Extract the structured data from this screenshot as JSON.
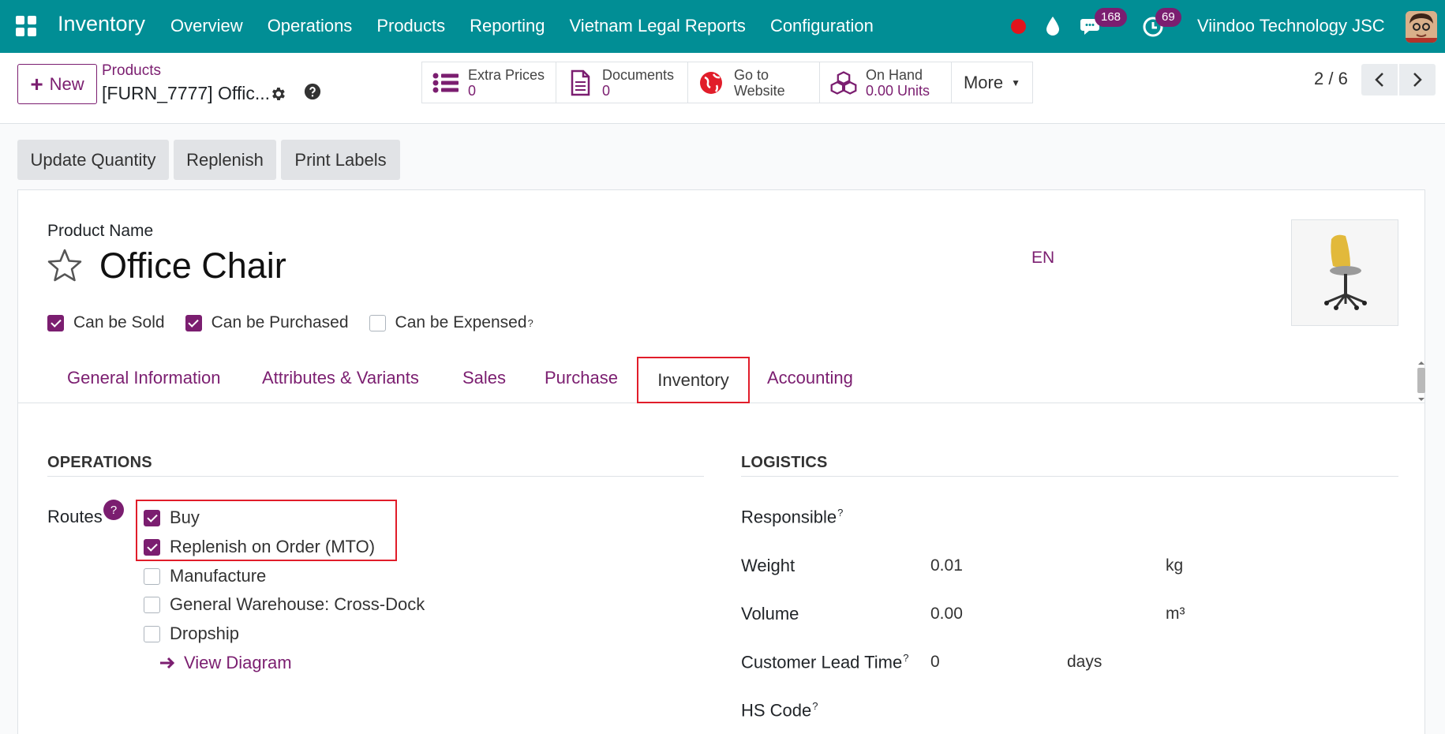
{
  "navbar": {
    "app_name": "Inventory",
    "menu": [
      "Overview",
      "Operations",
      "Products",
      "Reporting",
      "Vietnam Legal Reports",
      "Configuration"
    ],
    "messages_count": "168",
    "activities_count": "69",
    "company": "Viindoo Technology JSC",
    "bg_color": "#018e95"
  },
  "control": {
    "new_label": "New",
    "breadcrumb": "Products",
    "record_name": "[FURN_7777] Offic...",
    "smart_buttons": {
      "extra_prices": {
        "label": "Extra Prices",
        "value": "0"
      },
      "documents": {
        "label": "Documents",
        "value": "0"
      },
      "website": {
        "line1": "Go to",
        "line2": "Website"
      },
      "on_hand": {
        "label": "On Hand",
        "value": "0.00 Units"
      },
      "more": "More"
    },
    "pager": "2 / 6"
  },
  "actions": [
    "Update Quantity",
    "Replenish",
    "Print Labels"
  ],
  "form": {
    "product_name_label": "Product Name",
    "product_name": "Office Chair",
    "lang": "EN",
    "checkboxes": [
      {
        "label": "Can be Sold",
        "checked": true
      },
      {
        "label": "Can be Purchased",
        "checked": true
      },
      {
        "label": "Can be Expensed",
        "checked": false,
        "help": "?"
      }
    ],
    "tabs": [
      "General Information",
      "Attributes & Variants",
      "Sales",
      "Purchase",
      "Inventory",
      "Accounting"
    ],
    "active_tab": "Inventory",
    "operations": {
      "title": "OPERATIONS",
      "routes_label": "Routes",
      "help": "?",
      "routes": [
        {
          "label": "Buy",
          "checked": true
        },
        {
          "label": "Replenish on Order (MTO)",
          "checked": true
        },
        {
          "label": "Manufacture",
          "checked": false
        },
        {
          "label": "General Warehouse: Cross-Dock",
          "checked": false
        },
        {
          "label": "Dropship",
          "checked": false
        }
      ],
      "view_diagram": "View Diagram"
    },
    "logistics": {
      "title": "LOGISTICS",
      "responsible_label": "Responsible",
      "weight_label": "Weight",
      "weight_value": "0.01",
      "weight_unit": "kg",
      "volume_label": "Volume",
      "volume_value": "0.00",
      "volume_unit": "m³",
      "lead_time_label": "Customer Lead Time",
      "lead_time_value": "0",
      "lead_time_unit": "days",
      "hs_code_label": "HS Code",
      "help": "?"
    }
  },
  "accent_color": "#7b1e70",
  "highlight_color": "#e11d2a"
}
